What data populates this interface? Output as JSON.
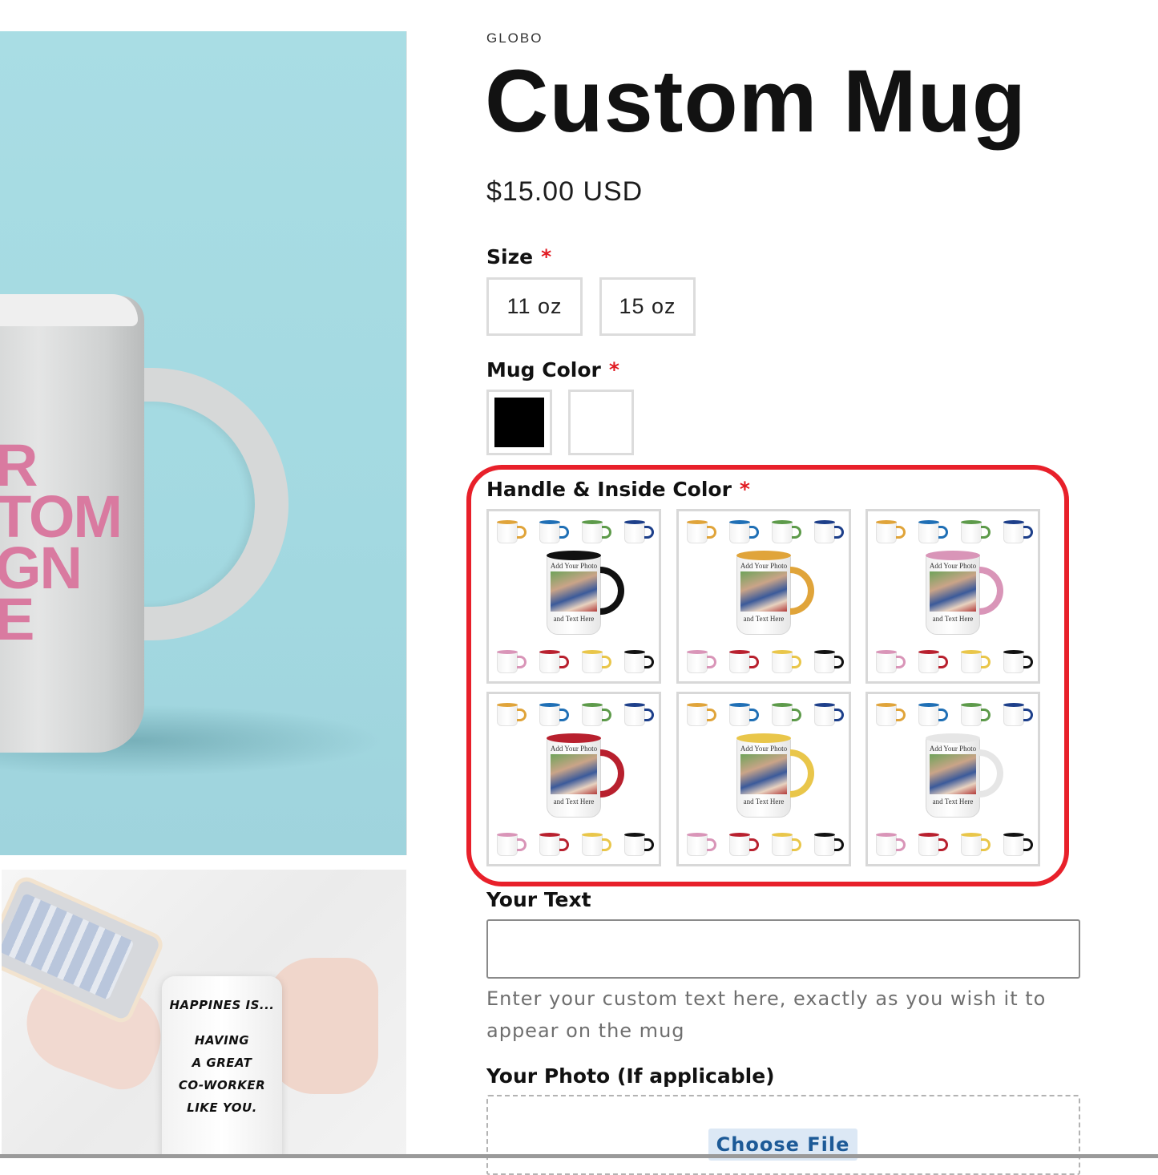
{
  "product": {
    "vendor": "GLOBO",
    "title": "Custom Mug",
    "price": "$15.00 USD"
  },
  "gallery": {
    "main_mug_print": "R\nTOM\nGN\nE",
    "secondary_mug_quote": [
      "HAPPINES IS...",
      "",
      "HAVING",
      "A GREAT",
      "CO-WORKER",
      "LIKE YOU."
    ]
  },
  "options": {
    "size": {
      "label": "Size",
      "required_mark": "*",
      "values": [
        "11 oz",
        "15 oz"
      ]
    },
    "mug_color": {
      "label": "Mug Color",
      "required_mark": "*",
      "swatches": [
        "#000000",
        "#ffffff"
      ]
    },
    "handle_color": {
      "label": "Handle & Inside Color",
      "required_mark": "*",
      "highlight_color": "#e8202a",
      "mug_caption_top": "Add Your Photo",
      "mug_caption_bottom": "and Text Here",
      "tiles": [
        {
          "handle": "#111111"
        },
        {
          "handle": "#e0a43a"
        },
        {
          "handle": "#d995b8"
        },
        {
          "handle": "#b8202e"
        },
        {
          "handle": "#e9c64a"
        },
        {
          "handle": "#e6e6e6"
        }
      ],
      "mini_colors_top": [
        "#e0a43a",
        "#1f6fb5",
        "#5d9a4a",
        "#1d3f8a"
      ],
      "mini_colors_bottom": [
        "#d995b8",
        "#b8202e",
        "#e9c64a",
        "#111111"
      ]
    },
    "your_text": {
      "label": "Your Text",
      "value": "",
      "help": "Enter your custom text here, exactly as you wish it to appear on the mug"
    },
    "your_photo": {
      "label": "Your Photo (If applicable)",
      "button": "Choose File"
    }
  }
}
